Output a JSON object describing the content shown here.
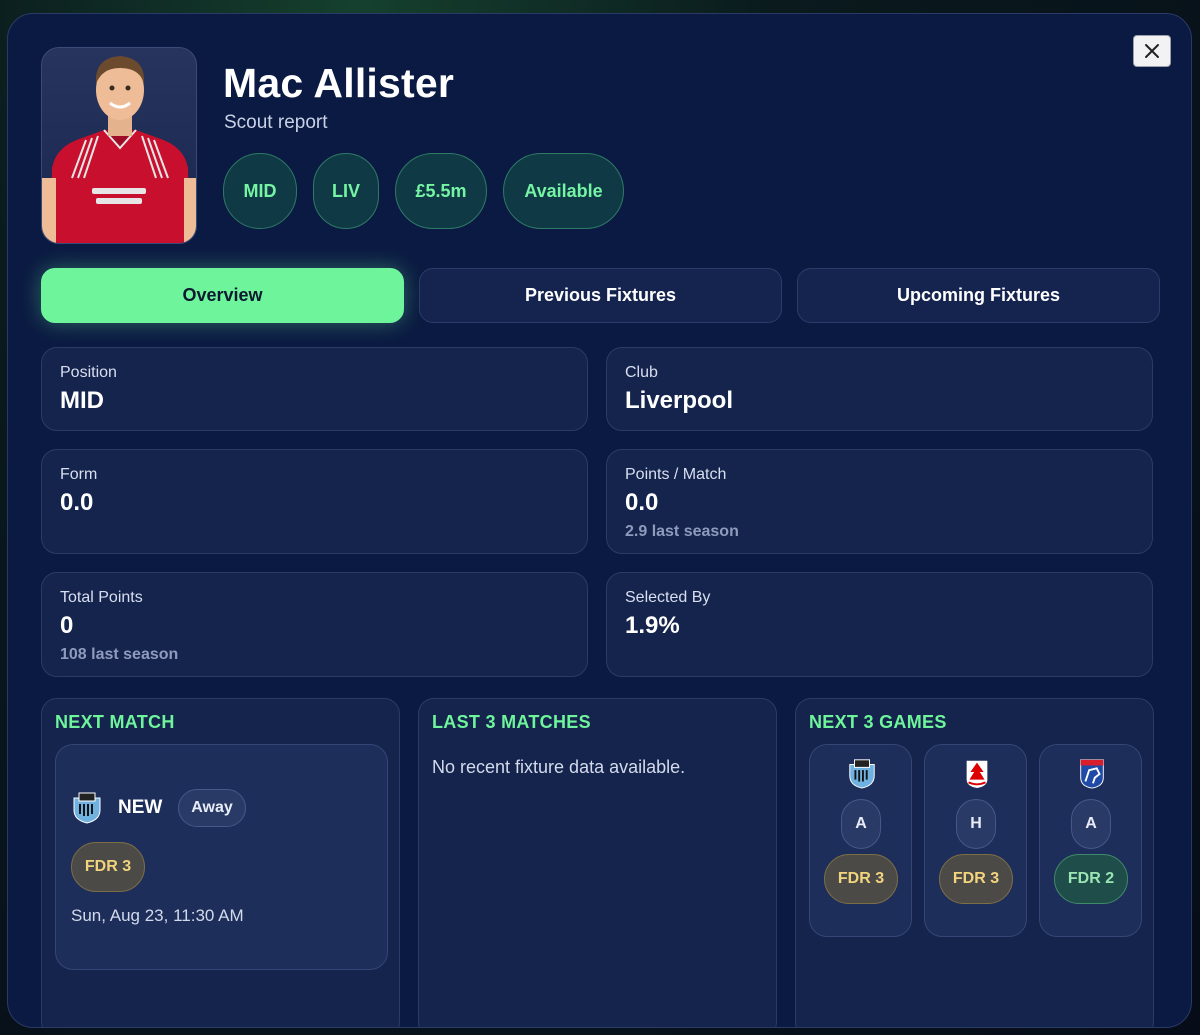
{
  "player": {
    "name": "Mac Allister",
    "subtitle": "Scout report",
    "chips": [
      "MID",
      "LIV",
      "£5.5m",
      "Available"
    ]
  },
  "tabs": [
    "Overview",
    "Previous Fixtures",
    "Upcoming Fixtures"
  ],
  "active_tab": "Overview",
  "stats": {
    "position": {
      "label": "Position",
      "value": "MID"
    },
    "club": {
      "label": "Club",
      "value": "Liverpool"
    },
    "form": {
      "label": "Form",
      "value": "0.0"
    },
    "ppm": {
      "label": "Points / Match",
      "value": "0.0",
      "sub": "2.9 last season"
    },
    "total": {
      "label": "Total Points",
      "value": "0",
      "sub": "108 last season"
    },
    "selected": {
      "label": "Selected By",
      "value": "1.9%"
    }
  },
  "next_match": {
    "title": "NEXT MATCH",
    "team": "NEW",
    "venue": "Away",
    "fdr": "FDR 3",
    "date": "Sun, Aug 23, 11:30 AM",
    "crest_icon": "newcastle-crest-icon"
  },
  "last_matches": {
    "title": "LAST 3 MATCHES",
    "empty_text": "No recent fixture data available."
  },
  "next_games": {
    "title": "NEXT 3 GAMES",
    "games": [
      {
        "crest_icon": "newcastle-crest-icon",
        "venue": "A",
        "fdr": "FDR 3",
        "fdr_color": "#f2d37e"
      },
      {
        "crest_icon": "nottingham-forest-crest-icon",
        "venue": "H",
        "fdr": "FDR 3",
        "fdr_color": "#f2d37e"
      },
      {
        "crest_icon": "ipswich-crest-icon",
        "venue": "A",
        "fdr": "FDR 2",
        "fdr_color": "#9ae5b4"
      }
    ]
  },
  "colors": {
    "accent": "#6ef59c",
    "panel": "#15244c",
    "background": "#0b1a42"
  }
}
